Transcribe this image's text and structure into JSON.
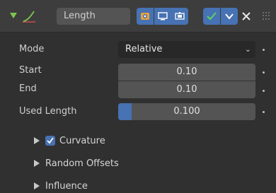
{
  "modifier": {
    "name": "Length"
  },
  "properties": {
    "mode_label": "Mode",
    "mode_value": "Relative",
    "start_label": "Start",
    "start_value": "0.10",
    "end_label": "End",
    "end_value": "0.10",
    "used_length_label": "Used Length",
    "used_length_value": "0.100",
    "used_length_fraction": 0.1
  },
  "subpanels": [
    {
      "label": "Curvature",
      "checked": true
    },
    {
      "label": "Random Offsets"
    },
    {
      "label": "Influence"
    }
  ],
  "icons": {
    "modifier": "length-curve-icon",
    "render": "render-camera-icon",
    "viewport": "viewport-monitor-icon",
    "edit": "edit-mode-icon",
    "check": "checkmark-icon",
    "dropdown": "chevron-down-icon",
    "close": "close-icon",
    "drag": "drag-handle-icon"
  },
  "colors": {
    "accent": "#4772b3",
    "modifier_green": "#7cc64c",
    "check_green": "#5fd35f"
  }
}
